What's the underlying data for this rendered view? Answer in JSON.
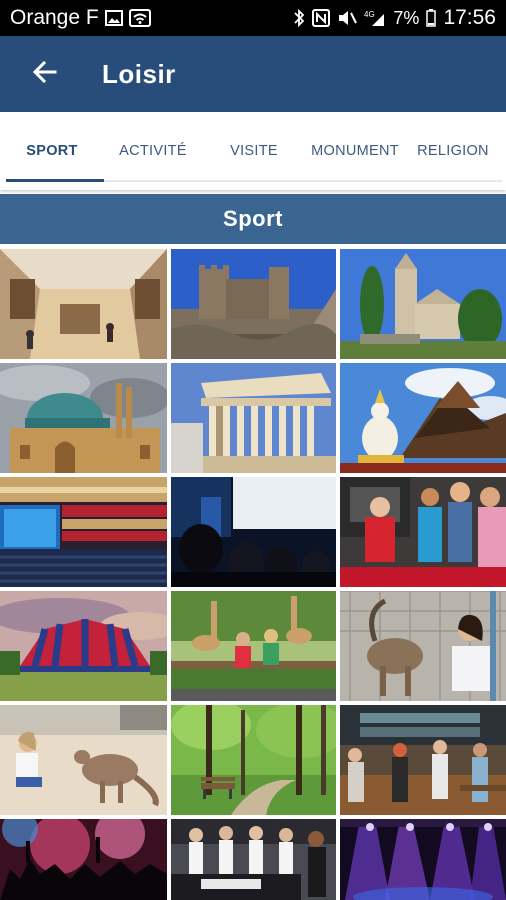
{
  "status_bar": {
    "carrier": "Orange F",
    "battery": "7%",
    "time": "17:56",
    "icons": [
      "image-icon",
      "wifi-icon",
      "bluetooth-icon",
      "nfc-icon",
      "mute-icon",
      "signal-icon",
      "battery-icon"
    ]
  },
  "app_bar": {
    "title": "Loisir",
    "back_icon": "arrow-left-icon",
    "color": "#294d7a"
  },
  "tabs": {
    "items": [
      {
        "label": "SPORT",
        "active": true
      },
      {
        "label": "ACTIVITÉ",
        "active": false
      },
      {
        "label": "VISITE",
        "active": false
      },
      {
        "label": "MONUMENT",
        "active": false
      },
      {
        "label": "RELIGION",
        "active": false
      }
    ]
  },
  "section": {
    "title": "Sport",
    "color": "#3a6590"
  },
  "grid": {
    "items": [
      {
        "subject": "museum-hall"
      },
      {
        "subject": "castle-ruin"
      },
      {
        "subject": "village-church"
      },
      {
        "subject": "mosque"
      },
      {
        "subject": "roman-temple"
      },
      {
        "subject": "buddhist-temple"
      },
      {
        "subject": "opera-theater"
      },
      {
        "subject": "cinema-audience"
      },
      {
        "subject": "escape-game-group"
      },
      {
        "subject": "circus-tent"
      },
      {
        "subject": "zoo-giraffes-children"
      },
      {
        "subject": "zoo-ibex-girl"
      },
      {
        "subject": "kangaroo-child"
      },
      {
        "subject": "park-bench-forest"
      },
      {
        "subject": "bar-friends"
      },
      {
        "subject": "nightclub-crowd"
      },
      {
        "subject": "gospel-choir"
      },
      {
        "subject": "concert-stage-lights"
      }
    ]
  }
}
